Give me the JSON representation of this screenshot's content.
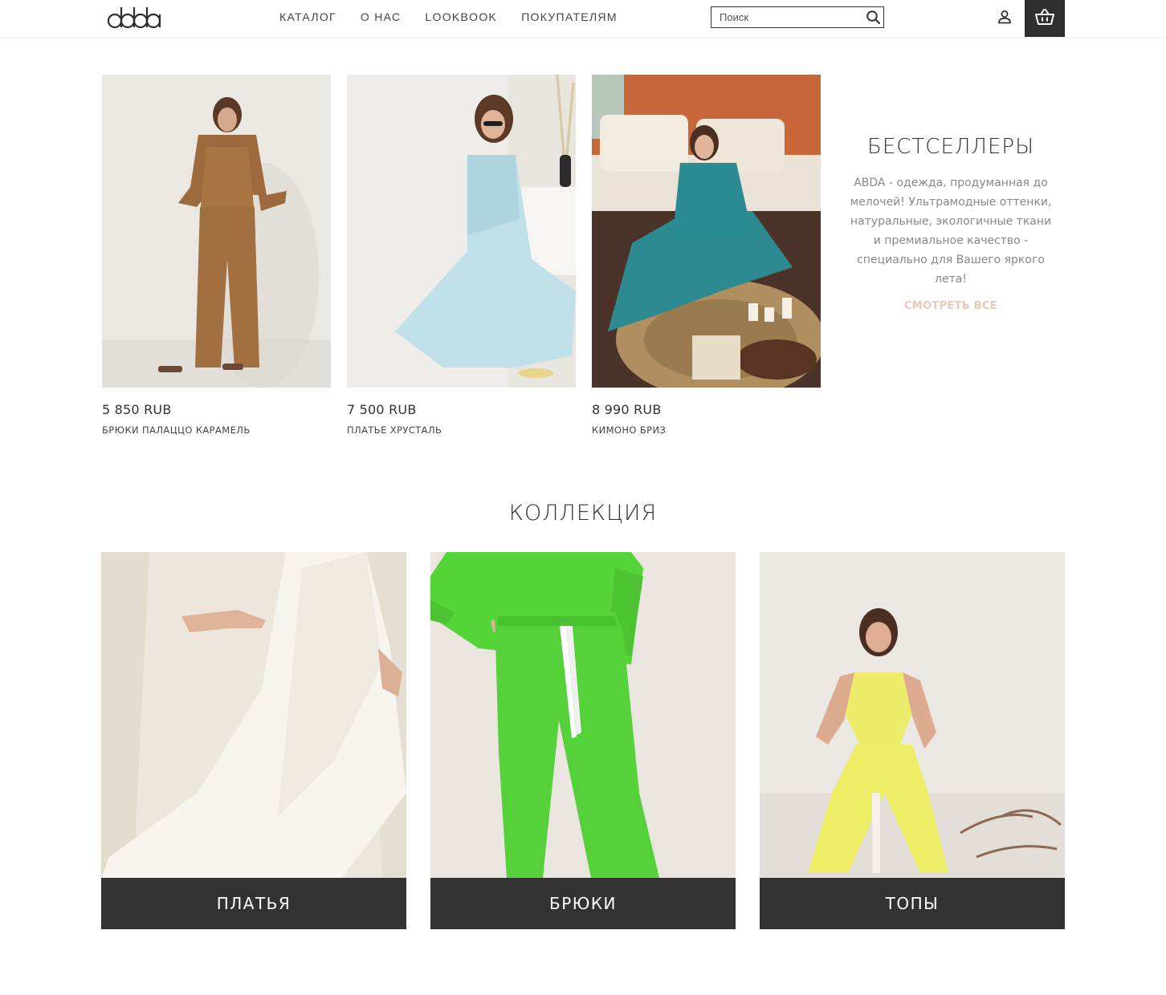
{
  "header": {
    "nav": [
      {
        "label": "КАТАЛОГ"
      },
      {
        "label": "О НАС"
      },
      {
        "label": "LOOKBOOK"
      },
      {
        "label": "ПОКУПАТЕЛЯМ"
      }
    ],
    "search": {
      "placeholder": "Поиск"
    }
  },
  "bestsellers": {
    "title": "БЕСТСЕЛЛЕРЫ",
    "description": "ABDA - одежда, продуманная до мелочей! Ультрамодные оттенки, натуральные, экологичные ткани и премиальное качество - специально для Вашего яркого лета!",
    "view_all": "СМОТРЕТЬ ВСЕ",
    "products": [
      {
        "price": "5 850 RUB",
        "name": "БРЮКИ ПАЛАЦЦО КАРАМЕЛЬ"
      },
      {
        "price": "7 500 RUB",
        "name": "ПЛАТЬЕ ХРУСТАЛЬ"
      },
      {
        "price": "8 990 RUB",
        "name": "КИМОНО БРИЗ"
      }
    ]
  },
  "collection": {
    "title": "КОЛЛЕКЦИЯ",
    "categories": [
      {
        "label": "ПЛАТЬЯ"
      },
      {
        "label": "БРЮКИ"
      },
      {
        "label": "ТОПЫ"
      }
    ]
  },
  "colors": {
    "dark": "#323232",
    "accent_link": "#e9c8b7",
    "muted_text": "#888888"
  }
}
